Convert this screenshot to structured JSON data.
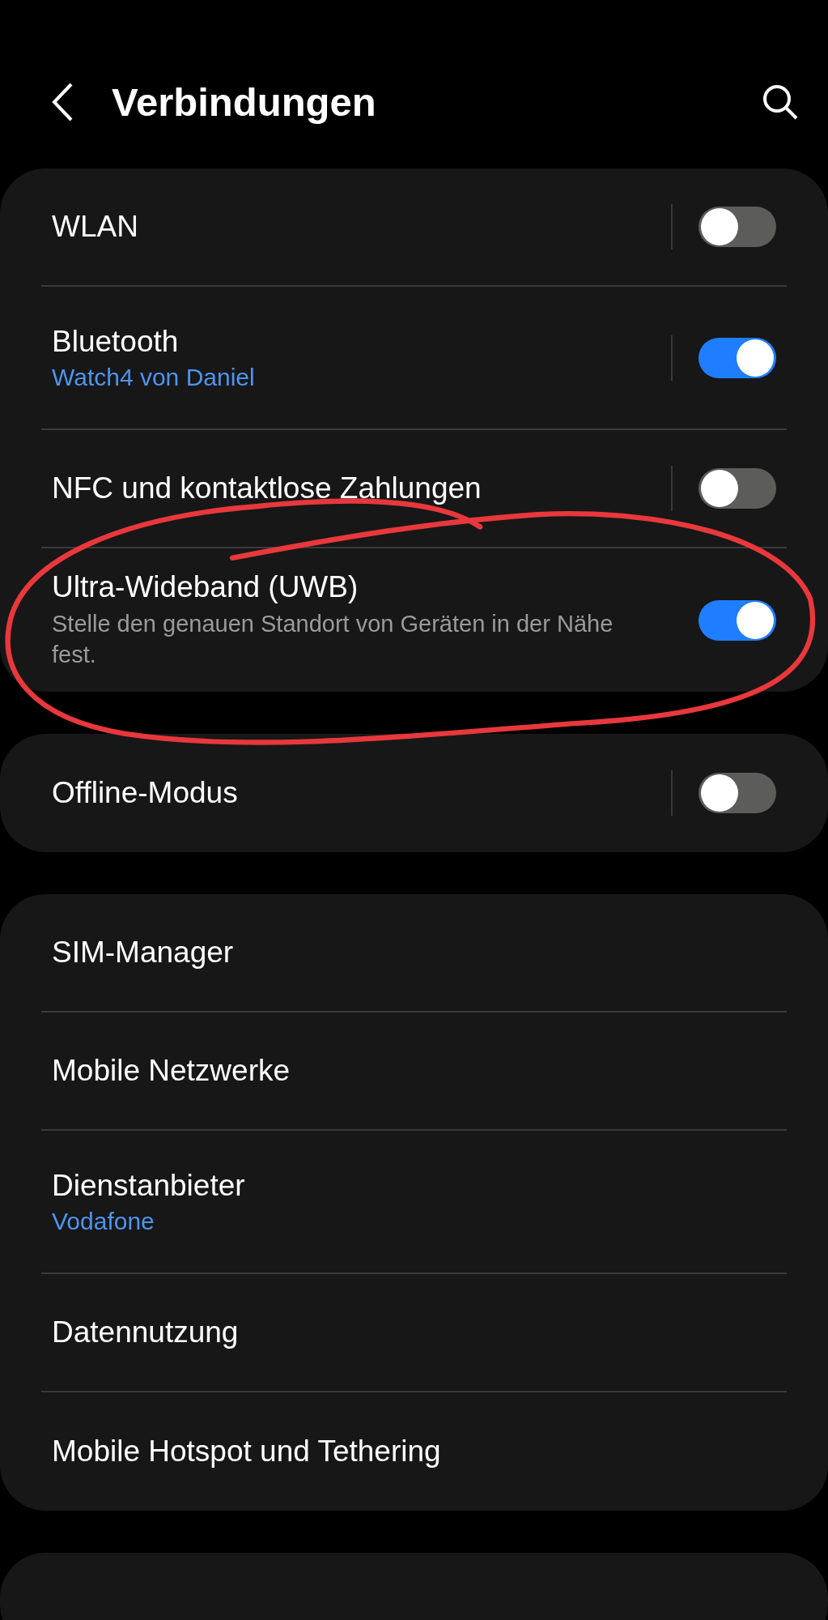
{
  "header": {
    "title": "Verbindungen"
  },
  "groups": [
    {
      "items": [
        {
          "kind": "toggle",
          "title": "WLAN",
          "on": false
        },
        {
          "kind": "toggle",
          "title": "Bluetooth",
          "status": "Watch4 von Daniel",
          "on": true
        },
        {
          "kind": "toggle",
          "title": "NFC und kontaktlose Zahlungen",
          "on": false
        },
        {
          "kind": "toggle",
          "title": "Ultra-Wideband (UWB)",
          "description": "Stelle den genauen Standort von Geräten in der Nähe fest.",
          "on": true
        }
      ]
    },
    {
      "items": [
        {
          "kind": "toggle",
          "title": "Offline-Modus",
          "on": false
        }
      ]
    },
    {
      "items": [
        {
          "kind": "link",
          "title": "SIM-Manager"
        },
        {
          "kind": "link",
          "title": "Mobile Netzwerke"
        },
        {
          "kind": "link",
          "title": "Dienstanbieter",
          "status": "Vodafone"
        },
        {
          "kind": "link",
          "title": "Datennutzung"
        },
        {
          "kind": "link",
          "title": "Mobile Hotspot und Tethering"
        }
      ]
    }
  ],
  "next_card": {
    "kind": "card"
  },
  "annotation": {
    "kind": "ellipse"
  }
}
